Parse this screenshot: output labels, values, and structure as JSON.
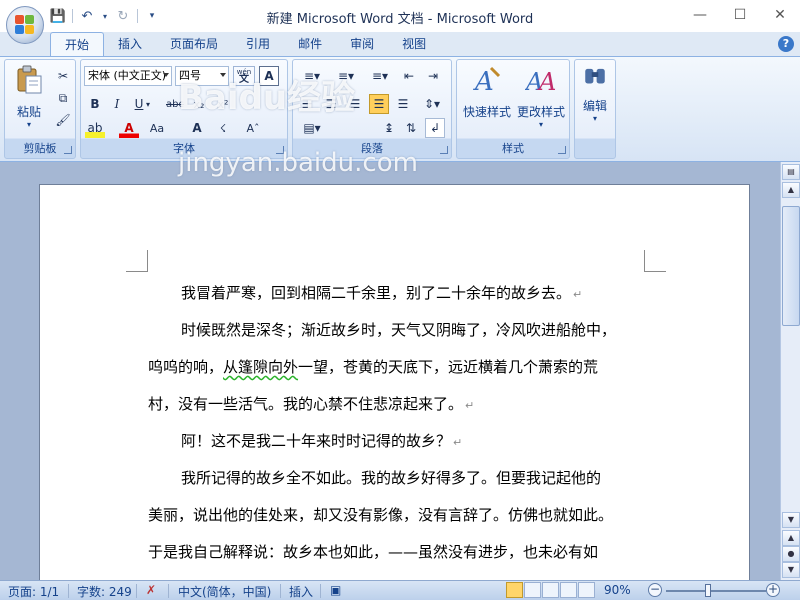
{
  "window": {
    "title": "新建 Microsoft Word 文档 - Microsoft Word",
    "controls": [
      "minimize",
      "maximize",
      "close"
    ]
  },
  "quick_access": [
    "save-icon",
    "undo-icon",
    "redo-icon",
    "customize-icon"
  ],
  "tabs": [
    {
      "label": "开始",
      "active": true
    },
    {
      "label": "插入"
    },
    {
      "label": "页面布局"
    },
    {
      "label": "引用"
    },
    {
      "label": "邮件"
    },
    {
      "label": "审阅"
    },
    {
      "label": "视图"
    }
  ],
  "ribbon": {
    "clipboard": {
      "label": "剪贴板",
      "paste": "粘贴"
    },
    "font": {
      "label": "字体",
      "name": "宋体 (中文正文)",
      "size": "四号",
      "wen": "wén",
      "char_border": "A"
    },
    "paragraph": {
      "label": "段落"
    },
    "styles": {
      "label": "样式",
      "quick_styles": "快速样式",
      "change_styles": "更改样式"
    },
    "editing": {
      "label": "编辑"
    }
  },
  "watermark": {
    "logo": "Baidu经验",
    "url": "jingyan.baidu.com"
  },
  "document": {
    "lines": [
      "我冒着严寒，回到相隔二千余里，别了二十余年的故乡去。",
      "时候既然是深冬；渐近故乡时，天气又阴晦了，冷风吹进船舱中，",
      "呜呜的响，",
      "从篷隙向外",
      "一望，苍黄的天底下，远近横着几个萧索的荒",
      "村，没有一些活气。我的心禁不住悲凉起来了。",
      "阿！这不是我二十年来时时记得的故乡？",
      "我所记得的故乡全不如此。我的故乡好得多了。但要我记起他的",
      "美丽，说出他的佳处来，却又没有影像，没有言辞了。仿佛也就如此。",
      "于是我自己解释说：故乡本也如此，——虽然没有进步，也未必有如"
    ],
    "paragraph_mark": "↵"
  },
  "status": {
    "page": "页面: 1/1",
    "words": "字数: 249",
    "language": "中文(简体，中国)",
    "mode": "插入",
    "zoom": "90%",
    "zoom_level_percent": 90
  },
  "colors": {
    "ribbon": "#dfe9f5",
    "doc_bg": "#a5b7d3",
    "accent": "#15428b"
  }
}
